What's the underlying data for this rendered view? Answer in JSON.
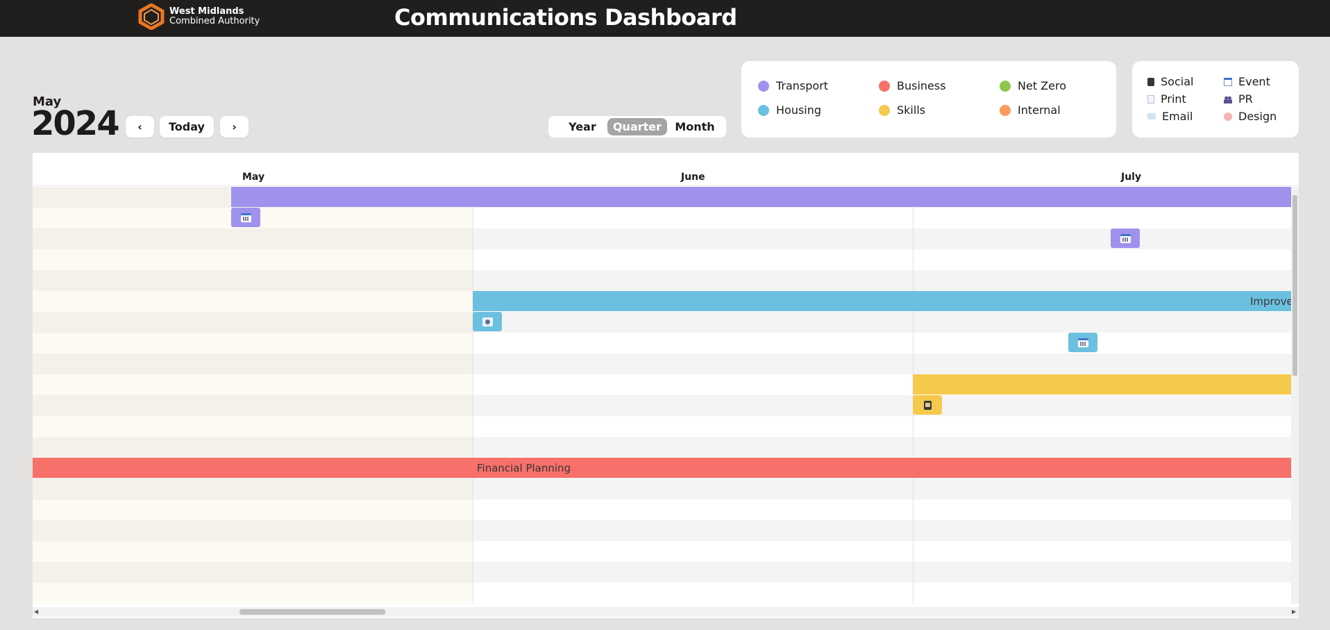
{
  "header": {
    "org_line1": "West Midlands",
    "org_line2": "Combined Authority",
    "title": "Communications Dashboard",
    "logo_icon": "hexagon-logo-icon",
    "logo_color": "#e87722"
  },
  "period": {
    "month": "May",
    "year": "2024"
  },
  "nav": {
    "prev": "‹",
    "today": "Today",
    "next": "›"
  },
  "view": {
    "options": [
      "Year",
      "Quarter",
      "Month"
    ],
    "selected": "Quarter"
  },
  "themes": [
    {
      "label": "Transport",
      "color": "#9f92ed"
    },
    {
      "label": "Business",
      "color": "#f7706a"
    },
    {
      "label": "Net Zero",
      "color": "#8fc74d"
    },
    {
      "label": "Housing",
      "color": "#6cc0df"
    },
    {
      "label": "Skills",
      "color": "#f5c94c"
    },
    {
      "label": "Internal",
      "color": "#fa9d5c"
    }
  ],
  "types": [
    {
      "label": "Social",
      "icon": "phone-icon"
    },
    {
      "label": "Event",
      "icon": "calendar-icon"
    },
    {
      "label": "Print",
      "icon": "document-icon"
    },
    {
      "label": "PR",
      "icon": "people-icon"
    },
    {
      "label": "Email",
      "icon": "envelope-icon"
    },
    {
      "label": "Design",
      "icon": "palette-icon"
    }
  ],
  "calendar": {
    "months": [
      "May",
      "June",
      "July"
    ],
    "bars": [
      {
        "theme": "Transport",
        "label": ""
      },
      {
        "theme": "Housing",
        "label": "Improve"
      },
      {
        "theme": "Skills",
        "label": ""
      },
      {
        "theme": "Business",
        "label": "Financial Planning"
      }
    ],
    "chips": [
      {
        "theme": "Transport",
        "type": "Event"
      },
      {
        "theme": "Transport",
        "type": "Event"
      },
      {
        "theme": "Housing",
        "type": "Email"
      },
      {
        "theme": "Housing",
        "type": "Event"
      },
      {
        "theme": "Skills",
        "type": "Social"
      }
    ]
  }
}
